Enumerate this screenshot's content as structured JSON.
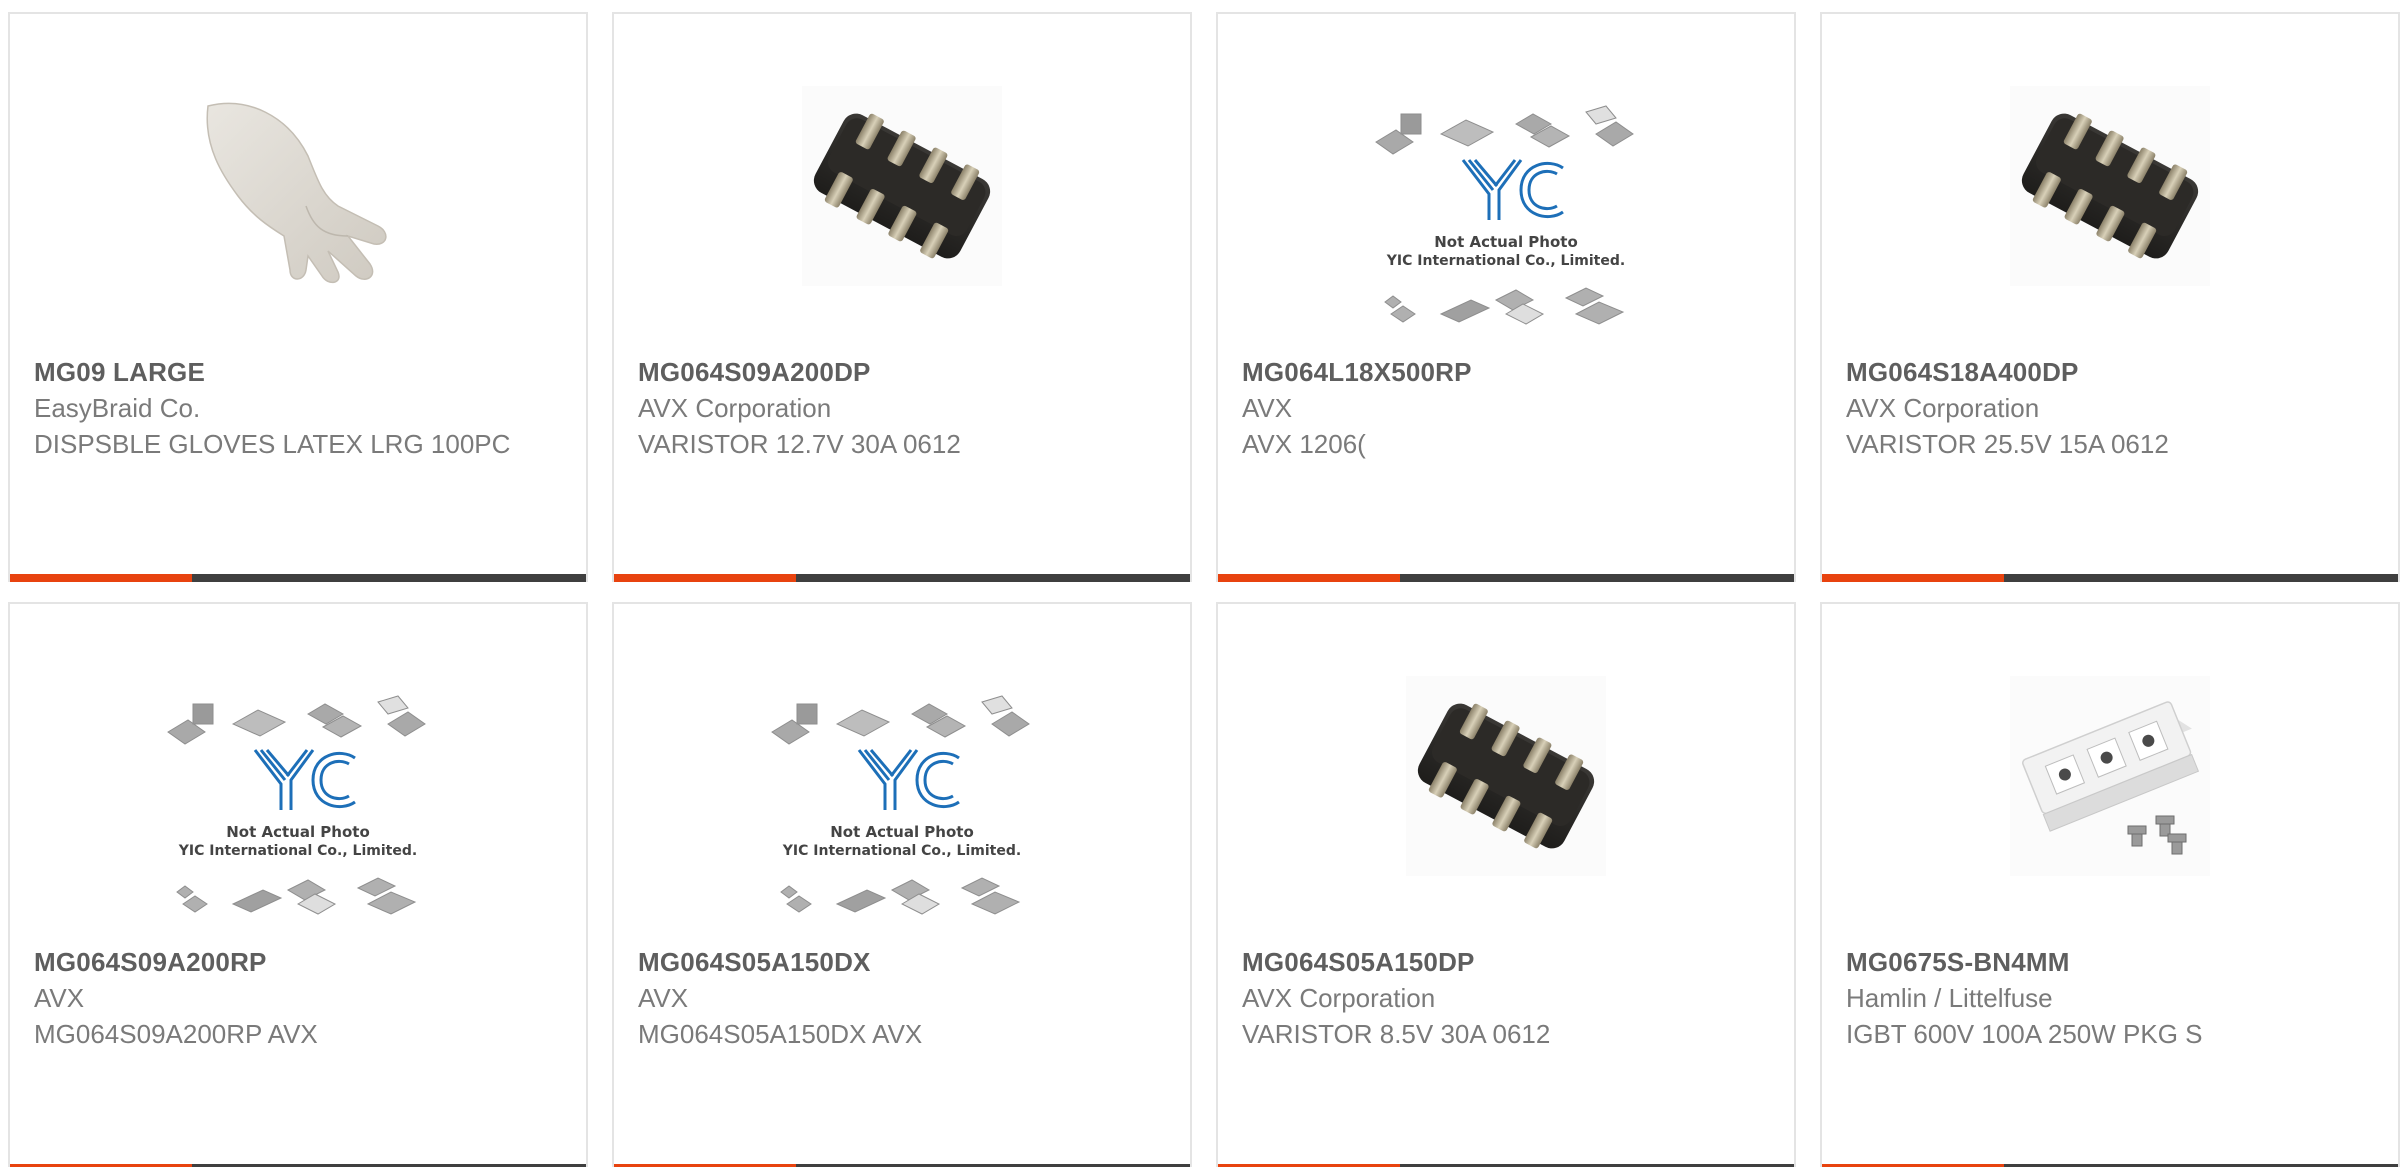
{
  "products": [
    {
      "part": "MG09 LARGE",
      "manufacturer": "EasyBraid Co.",
      "description": "DISPSBLE GLOVES LATEX LRG 100PC",
      "image": "glove-photo"
    },
    {
      "part": "MG064S09A200DP",
      "manufacturer": "AVX Corporation",
      "description": "VARISTOR 12.7V 30A 0612",
      "image": "chip-array-photo"
    },
    {
      "part": "MG064L18X500RP",
      "manufacturer": "AVX",
      "description": "AVX 1206(",
      "image": "placeholder-not-actual-photo",
      "placeholder": {
        "logo": "YIC",
        "line1": "Not Actual Photo",
        "line2": "YIC International Co., Limited."
      }
    },
    {
      "part": "MG064S18A400DP",
      "manufacturer": "AVX Corporation",
      "description": "VARISTOR 25.5V 15A 0612",
      "image": "chip-array-photo"
    },
    {
      "part": "MG064S09A200RP",
      "manufacturer": "AVX",
      "description": "MG064S09A200RP AVX",
      "image": "placeholder-not-actual-photo",
      "placeholder": {
        "logo": "YIC",
        "line1": "Not Actual Photo",
        "line2": "YIC International Co., Limited."
      }
    },
    {
      "part": "MG064S05A150DX",
      "manufacturer": "AVX",
      "description": "MG064S05A150DX AVX",
      "image": "placeholder-not-actual-photo",
      "placeholder": {
        "logo": "YIC",
        "line1": "Not Actual Photo",
        "line2": "YIC International Co., Limited."
      }
    },
    {
      "part": "MG064S05A150DP",
      "manufacturer": "AVX Corporation",
      "description": "VARISTOR 8.5V 30A 0612",
      "image": "chip-array-photo"
    },
    {
      "part": "MG0675S-BN4MM",
      "manufacturer": "Hamlin / Littelfuse",
      "description": "IGBT 600V 100A 250W PKG S",
      "image": "igbt-module-photo"
    }
  ],
  "colors": {
    "accent": "#e8430f",
    "bar": "#3f3f3f",
    "border": "#e4e4e4",
    "logo_blue": "#1d6fb8"
  }
}
